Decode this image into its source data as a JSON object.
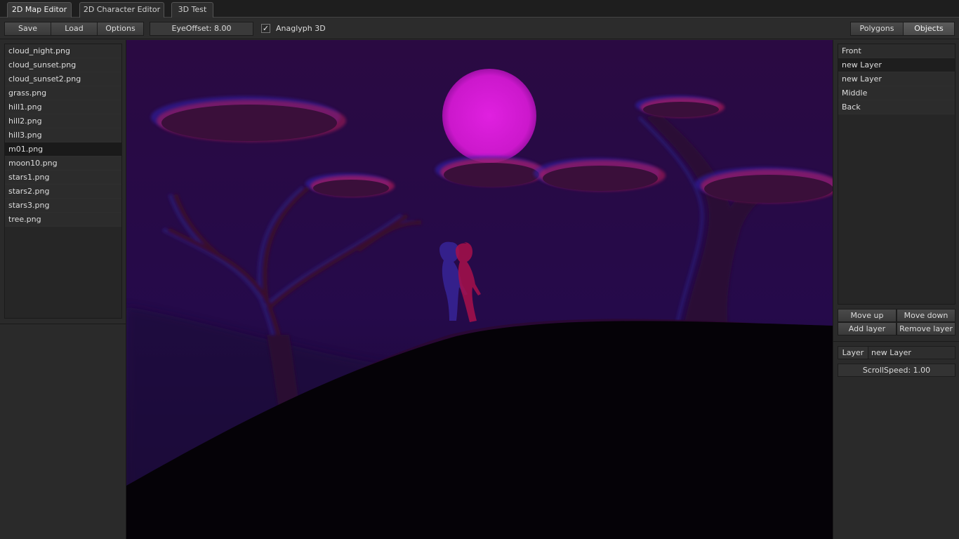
{
  "tabs": [
    {
      "label": "2D Map Editor",
      "active": true
    },
    {
      "label": "2D Character Editor",
      "active": false
    },
    {
      "label": "3D Test",
      "active": false
    }
  ],
  "toolbar": {
    "save_label": "Save",
    "load_label": "Load",
    "options_label": "Options",
    "eye_offset": "EyeOffset: 8.00",
    "anaglyph_label": "Anaglyph 3D",
    "anaglyph_checked": true,
    "polygons_label": "Polygons",
    "objects_label": "Objects",
    "checkmark": "✓"
  },
  "assets": {
    "items": [
      "cloud_night.png",
      "cloud_sunset.png",
      "cloud_sunset2.png",
      "grass.png",
      "hill1.png",
      "hill2.png",
      "hill3.png",
      "m01.png",
      "moon10.png",
      "stars1.png",
      "stars2.png",
      "stars3.png",
      "tree.png"
    ],
    "selected": "m01.png"
  },
  "layers": {
    "items": [
      "Front",
      "new Layer",
      "new Layer",
      "Middle",
      "Back"
    ],
    "selected_index": 1,
    "move_up_label": "Move up",
    "move_down_label": "Move down",
    "add_layer_label": "Add layer",
    "remove_layer_label": "Remove layer"
  },
  "properties": {
    "layer_label": "Layer",
    "layer_name": "new Layer",
    "scroll_speed": "ScrollSpeed: 1.00"
  },
  "colors": {
    "sky_top": "#2a0a45",
    "sky_bottom": "#1a0838",
    "moon": "#d61ad6",
    "cloud_red": "#c01a5a",
    "cloud_blue": "#3a20c0",
    "hill": "#050208"
  }
}
